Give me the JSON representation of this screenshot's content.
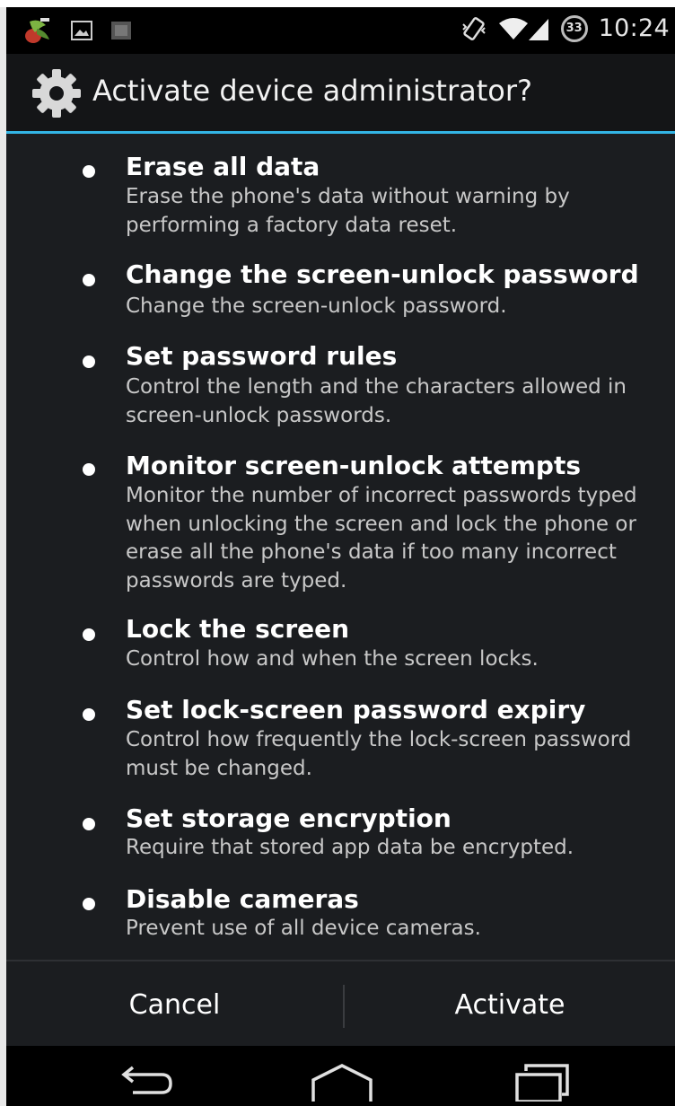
{
  "status_bar": {
    "time": "10:24",
    "battery_level": "33",
    "icons": [
      "app-notification-icon",
      "image-notification-icon",
      "gallery-notification-icon",
      "vibrate-icon",
      "wifi-icon",
      "signal-icon",
      "battery-icon"
    ]
  },
  "dialog": {
    "title": "Activate device administrator?",
    "accent_color": "#33b5e5",
    "policies": [
      {
        "title": "Erase all data",
        "description": "Erase the phone's data without warning by performing a factory data reset."
      },
      {
        "title": "Change the screen-unlock password",
        "description": "Change the screen-unlock password."
      },
      {
        "title": "Set password rules",
        "description": "Control the length and the characters allowed in screen-unlock passwords."
      },
      {
        "title": "Monitor screen-unlock attempts",
        "description": "Monitor the number of incorrect passwords typed when unlocking the screen and lock the phone or erase all the phone's data if too many incorrect passwords are typed."
      },
      {
        "title": "Lock the screen",
        "description": "Control how and when the screen locks."
      },
      {
        "title": "Set lock-screen password expiry",
        "description": "Control how frequently the lock-screen password must be changed."
      },
      {
        "title": "Set storage encryption",
        "description": "Require that stored app data be encrypted."
      },
      {
        "title": "Disable cameras",
        "description": "Prevent use of all device cameras."
      }
    ],
    "buttons": {
      "cancel": "Cancel",
      "activate": "Activate"
    }
  },
  "nav_bar": {
    "icons": [
      "back-icon",
      "home-icon",
      "recent-apps-icon"
    ]
  }
}
